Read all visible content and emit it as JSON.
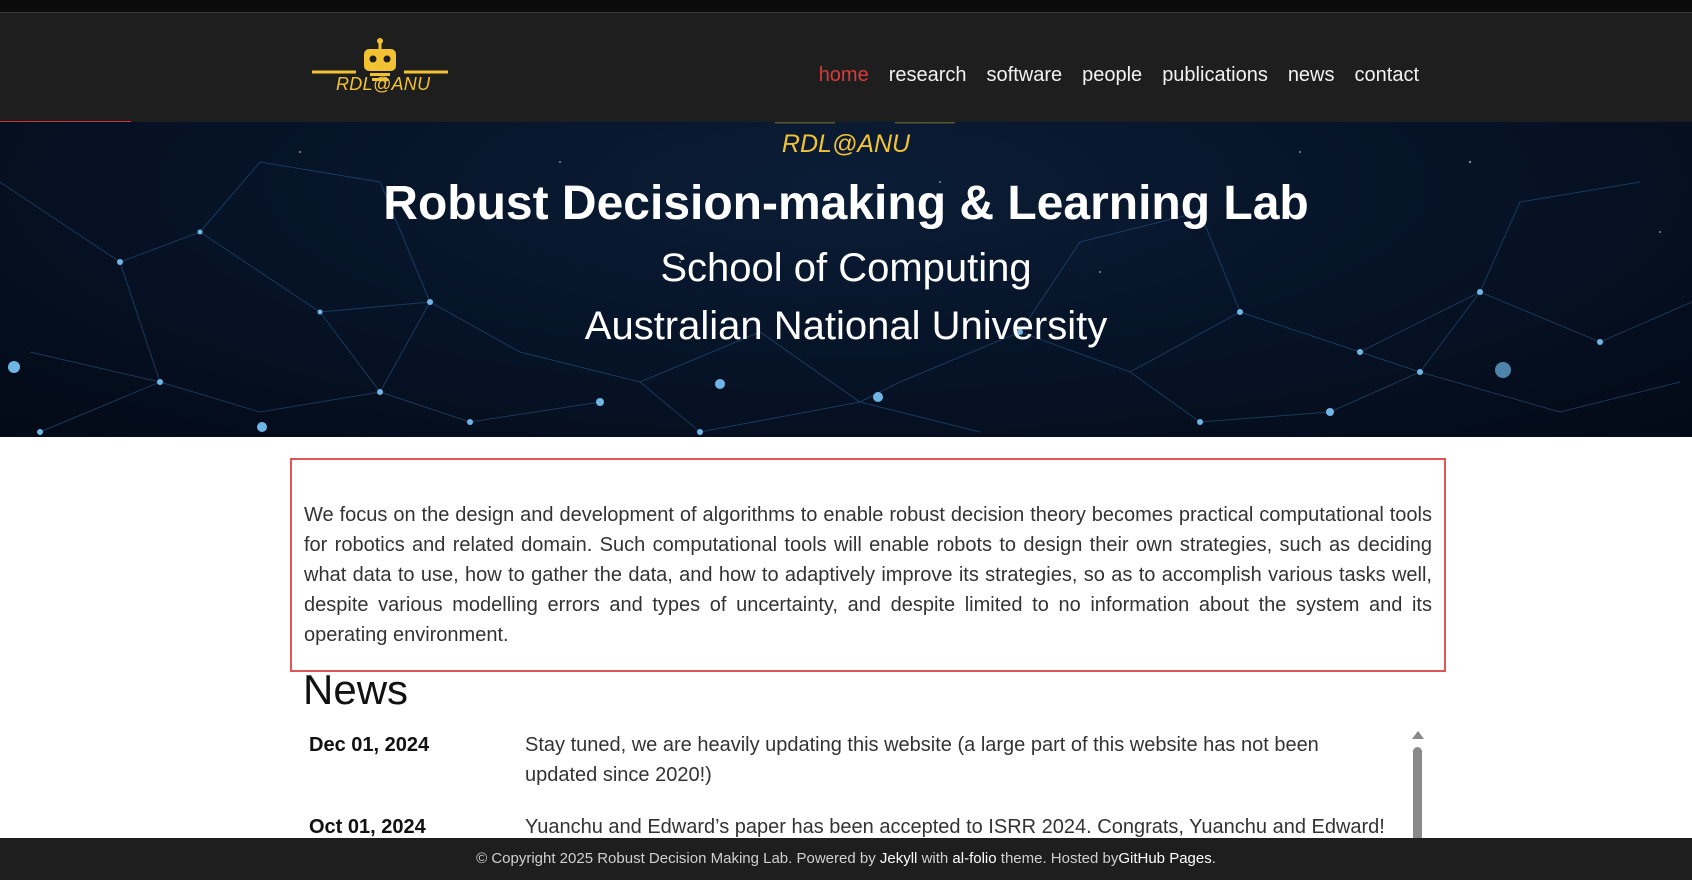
{
  "brand": {
    "logo_text": "RDL@ANU",
    "logo_color": "#f1c232"
  },
  "nav": {
    "items": [
      {
        "label": "home",
        "active": true
      },
      {
        "label": "research"
      },
      {
        "label": "software"
      },
      {
        "label": "people"
      },
      {
        "label": "publications"
      },
      {
        "label": "news"
      },
      {
        "label": "contact"
      }
    ],
    "active_color": "#d93a3a"
  },
  "hero": {
    "logo_text": "RDL@ANU",
    "title": "Robust Decision-making & Learning Lab",
    "subtitle_1": "School of Computing",
    "subtitle_2": "Australian National University"
  },
  "about": {
    "text": "We focus on the design and development of algorithms to enable robust decision theory becomes practical computational tools for robotics and related domain. Such computational tools will enable robots to design their own strategies, such as deciding what data to use, how to gather the data, and how to adaptively improve its strategies, so as to accomplish various tasks well, despite various modelling errors and types of uncertainty, and despite limited to no information about the system and its operating environment."
  },
  "news": {
    "heading": "News",
    "items": [
      {
        "date": "Dec 01, 2024",
        "text": "Stay tuned, we are heavily updating this website (a large part of this website has not been updated since 2020!)"
      },
      {
        "date": "Oct 01, 2024",
        "text": "Yuanchu and Edward’s paper has been accepted to ISRR 2024. Congrats, Yuanchu and Edward!"
      }
    ]
  },
  "footer": {
    "prefix": "© Copyright 2025 Robust Decision Making Lab. Powered by",
    "jekyll": "Jekyll",
    "with": "with",
    "alfolio": "al-folio",
    "hosted": "theme. Hosted by",
    "github": "GitHub Pages",
    "suffix": "."
  }
}
